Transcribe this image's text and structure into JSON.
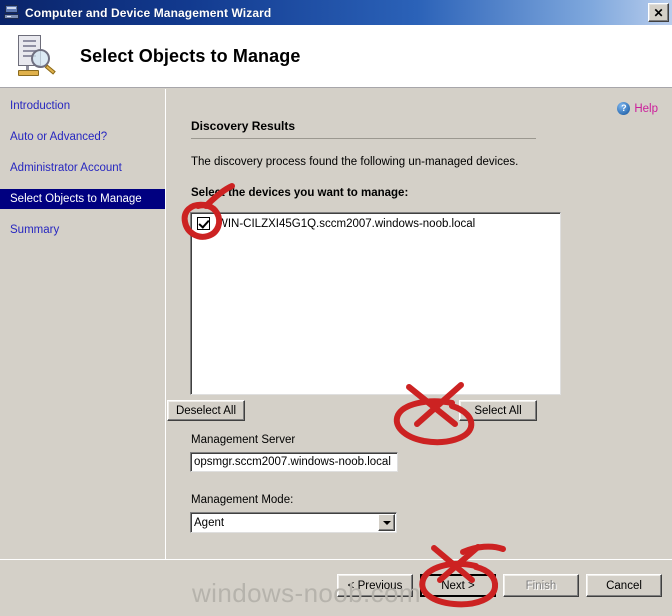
{
  "window": {
    "title": "Computer and Device Management Wizard",
    "icon": "computer-monitor-icon",
    "close_label": "✕",
    "titlebar_gradient_start": "#0a246a",
    "titlebar_gradient_end": "#b9cdec"
  },
  "header": {
    "title": "Select Objects to Manage",
    "icon": "server-magnifier-icon"
  },
  "sidebar": {
    "items": [
      {
        "label": "Introduction",
        "active": false
      },
      {
        "label": "Auto or Advanced?",
        "active": false
      },
      {
        "label": "Administrator Account",
        "active": false
      },
      {
        "label": "Select Objects to Manage",
        "active": true
      },
      {
        "label": "Summary",
        "active": false
      }
    ],
    "link_color": "#2727c0",
    "active_bg": "#000080"
  },
  "content": {
    "help": {
      "label": "Help",
      "icon": "question-circle-icon",
      "color": "#cc1c9b"
    },
    "section_heading": "Discovery Results",
    "description": "The discovery process found the following un-managed devices.",
    "select_prompt": "Select the devices you want to manage:",
    "device_list": [
      {
        "name": "WIN-CILZXI45G1Q.sccm2007.windows-noob.local",
        "checked": true
      }
    ],
    "select_all_label": "Select All",
    "deselect_all_label": "Deselect All",
    "management_server_label": "Management Server",
    "management_server_value": "opsmgr.sccm2007.windows-noob.local",
    "management_mode_label": "Management Mode:",
    "management_mode_value": "Agent",
    "management_mode_options": [
      "Agent"
    ]
  },
  "footer": {
    "previous_label": "< Previous",
    "next_label": "Next >",
    "finish_label": "Finish",
    "cancel_label": "Cancel",
    "finish_disabled": true
  },
  "watermark": {
    "text": "windows-noob.com",
    "color": "#b6b3ac"
  },
  "annotations": {
    "color": "#cc2222",
    "marks": [
      "circle-around-device-checkbox",
      "x-mark-above-select-all",
      "circle-around-select-all-button",
      "x-mark-above-next-button",
      "circle-around-next-button"
    ]
  }
}
